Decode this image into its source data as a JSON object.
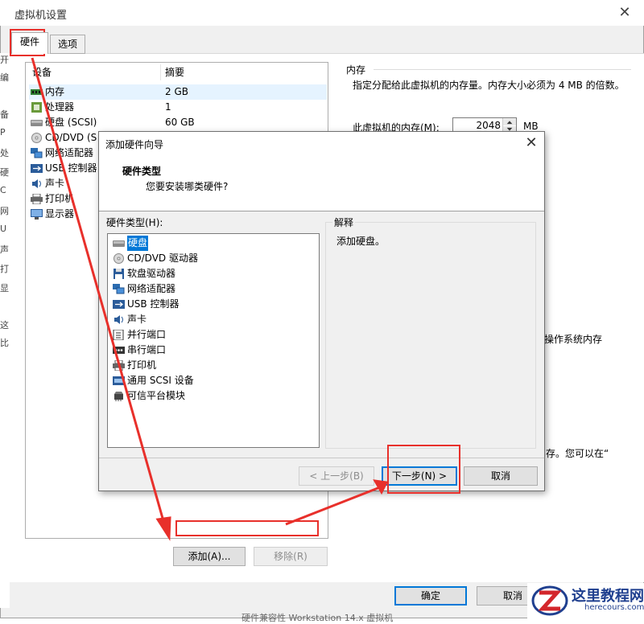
{
  "window": {
    "title": "虚拟机设置",
    "close_glyph": "✕"
  },
  "left_strip": [
    "开",
    "编",
    "备",
    "P",
    "处",
    "硬",
    "C",
    "网",
    "U",
    "声",
    "打",
    "显",
    "这",
    "比"
  ],
  "tabs": [
    {
      "label": "硬件"
    },
    {
      "label": "选项"
    }
  ],
  "device_table": {
    "headers": [
      "设备",
      "摘要"
    ],
    "rows": [
      {
        "name": "内存",
        "summary": "2 GB",
        "icon": "memory-icon"
      },
      {
        "name": "处理器",
        "summary": "1",
        "icon": "cpu-icon"
      },
      {
        "name": "硬盘 (SCSI)",
        "summary": "60 GB",
        "icon": "hard-disk-icon"
      },
      {
        "name": "CD/DVD (S",
        "summary": "",
        "icon": "cd-dvd-icon"
      },
      {
        "name": "网络适配器",
        "summary": "",
        "icon": "network-adapter-icon"
      },
      {
        "name": "USB 控制器",
        "summary": "",
        "icon": "usb-icon"
      },
      {
        "name": "声卡",
        "summary": "",
        "icon": "sound-card-icon"
      },
      {
        "name": "打印机",
        "summary": "",
        "icon": "printer-icon"
      },
      {
        "name": "显示器",
        "summary": "",
        "icon": "display-icon"
      }
    ]
  },
  "memory": {
    "group_title": "内存",
    "description": "指定分配给此虚拟机的内存量。内存大小必须为 4 MB 的倍数。",
    "label": "此虚拟机的内存(M):",
    "value": "2048",
    "unit": "MB",
    "os_memory_text": "操作系统内存",
    "note_text": "存。您可以在“"
  },
  "buttons": {
    "add": "添加(A)...",
    "remove": "移除(R)",
    "ok": "确定",
    "cancel": "取消"
  },
  "wizard": {
    "title": "添加硬件向导",
    "close_glyph": "✕",
    "heading": "硬件类型",
    "subheading": "您要安装哪类硬件?",
    "list_label": "硬件类型(H):",
    "items": [
      {
        "label": "硬盘",
        "icon": "hard-disk-icon",
        "selected": true
      },
      {
        "label": "CD/DVD 驱动器",
        "icon": "cd-dvd-icon",
        "selected": false
      },
      {
        "label": "软盘驱动器",
        "icon": "floppy-icon",
        "selected": false
      },
      {
        "label": "网络适配器",
        "icon": "network-adapter-icon",
        "selected": false
      },
      {
        "label": "USB 控制器",
        "icon": "usb-icon",
        "selected": false
      },
      {
        "label": "声卡",
        "icon": "sound-card-icon",
        "selected": false
      },
      {
        "label": "并行端口",
        "icon": "parallel-port-icon",
        "selected": false
      },
      {
        "label": "串行端口",
        "icon": "serial-port-icon",
        "selected": false
      },
      {
        "label": "打印机",
        "icon": "printer-icon",
        "selected": false
      },
      {
        "label": "通用 SCSI 设备",
        "icon": "scsi-icon",
        "selected": false
      },
      {
        "label": "可信平台模块",
        "icon": "tpm-icon",
        "selected": false
      }
    ],
    "explain_title": "解释",
    "explain_text": "添加硬盘。",
    "back_label": "< 上一步(B)",
    "next_label": "下一步(N) >",
    "cancel_label": "取消"
  },
  "watermark": {
    "cn": "这里教程网",
    "en": "herecours.com"
  },
  "bottom_text": "硬件兼容性  Workstation 14.x 虚拟机",
  "colors": {
    "accent": "#0078d7",
    "annotation_red": "#e8302b",
    "selection": "#e5f3ff",
    "watermark": "#1f3f8f"
  }
}
